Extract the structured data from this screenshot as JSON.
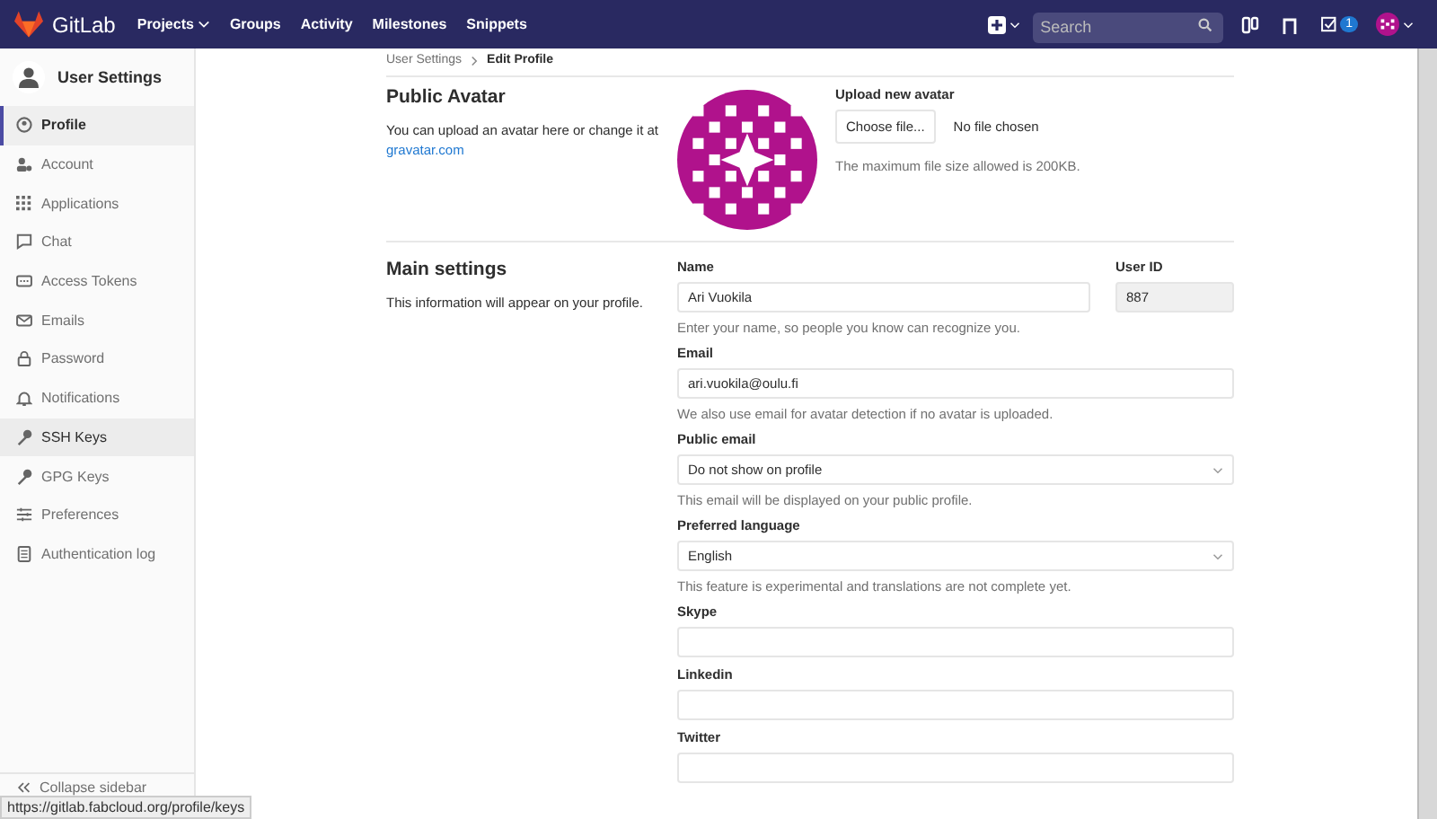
{
  "topbar": {
    "brand": "GitLab",
    "nav": [
      {
        "label": "Projects",
        "dropdown": true
      },
      {
        "label": "Groups",
        "dropdown": false
      },
      {
        "label": "Activity",
        "dropdown": false
      },
      {
        "label": "Milestones",
        "dropdown": false
      },
      {
        "label": "Snippets",
        "dropdown": false
      }
    ],
    "search": {
      "placeholder": "Search"
    },
    "todo_count": "1"
  },
  "sidebar": {
    "title": "User Settings",
    "items": [
      {
        "label": "Profile",
        "selected": true,
        "hovered": false
      },
      {
        "label": "Account",
        "selected": false,
        "hovered": false
      },
      {
        "label": "Applications",
        "selected": false,
        "hovered": false
      },
      {
        "label": "Chat",
        "selected": false,
        "hovered": false
      },
      {
        "label": "Access Tokens",
        "selected": false,
        "hovered": false
      },
      {
        "label": "Emails",
        "selected": false,
        "hovered": false
      },
      {
        "label": "Password",
        "selected": false,
        "hovered": false
      },
      {
        "label": "Notifications",
        "selected": false,
        "hovered": false
      },
      {
        "label": "SSH Keys",
        "selected": false,
        "hovered": true
      },
      {
        "label": "GPG Keys",
        "selected": false,
        "hovered": false
      },
      {
        "label": "Preferences",
        "selected": false,
        "hovered": false
      },
      {
        "label": "Authentication log",
        "selected": false,
        "hovered": false
      }
    ],
    "collapse": "Collapse sidebar"
  },
  "breadcrumb": [
    {
      "label": "User Settings"
    },
    {
      "label": "Edit Profile"
    }
  ],
  "avatar_section": {
    "title": "Public Avatar",
    "text": "You can upload an avatar here or change it at",
    "link": "gravatar.com",
    "upload_label": "Upload new avatar",
    "choose_button": "Choose file...",
    "file_status": "No file chosen",
    "hint": "The maximum file size allowed is 200KB."
  },
  "main_settings": {
    "title": "Main settings",
    "text": "This information will appear on your profile.",
    "fields": [
      {
        "kind": "text",
        "label": "Name",
        "value": "Ari Vuokila",
        "help": "Enter your name, so people you know can recognize you.",
        "user_id": {
          "label": "User ID",
          "value": "887"
        }
      },
      {
        "kind": "text",
        "label": "Email",
        "value": "ari.vuokila@oulu.fi",
        "help": "We also use email for avatar detection if no avatar is uploaded."
      },
      {
        "kind": "select",
        "label": "Public email",
        "value": "Do not show on profile",
        "help": "This email will be displayed on your public profile."
      },
      {
        "kind": "select",
        "label": "Preferred language",
        "value": "English",
        "help": "This feature is experimental and translations are not complete yet."
      },
      {
        "kind": "text",
        "label": "Skype"
      },
      {
        "kind": "text",
        "label": "Linkedin"
      },
      {
        "kind": "text",
        "label": "Twitter"
      }
    ]
  },
  "status_url": "https://gitlab.fabcloud.org/profile/keys"
}
